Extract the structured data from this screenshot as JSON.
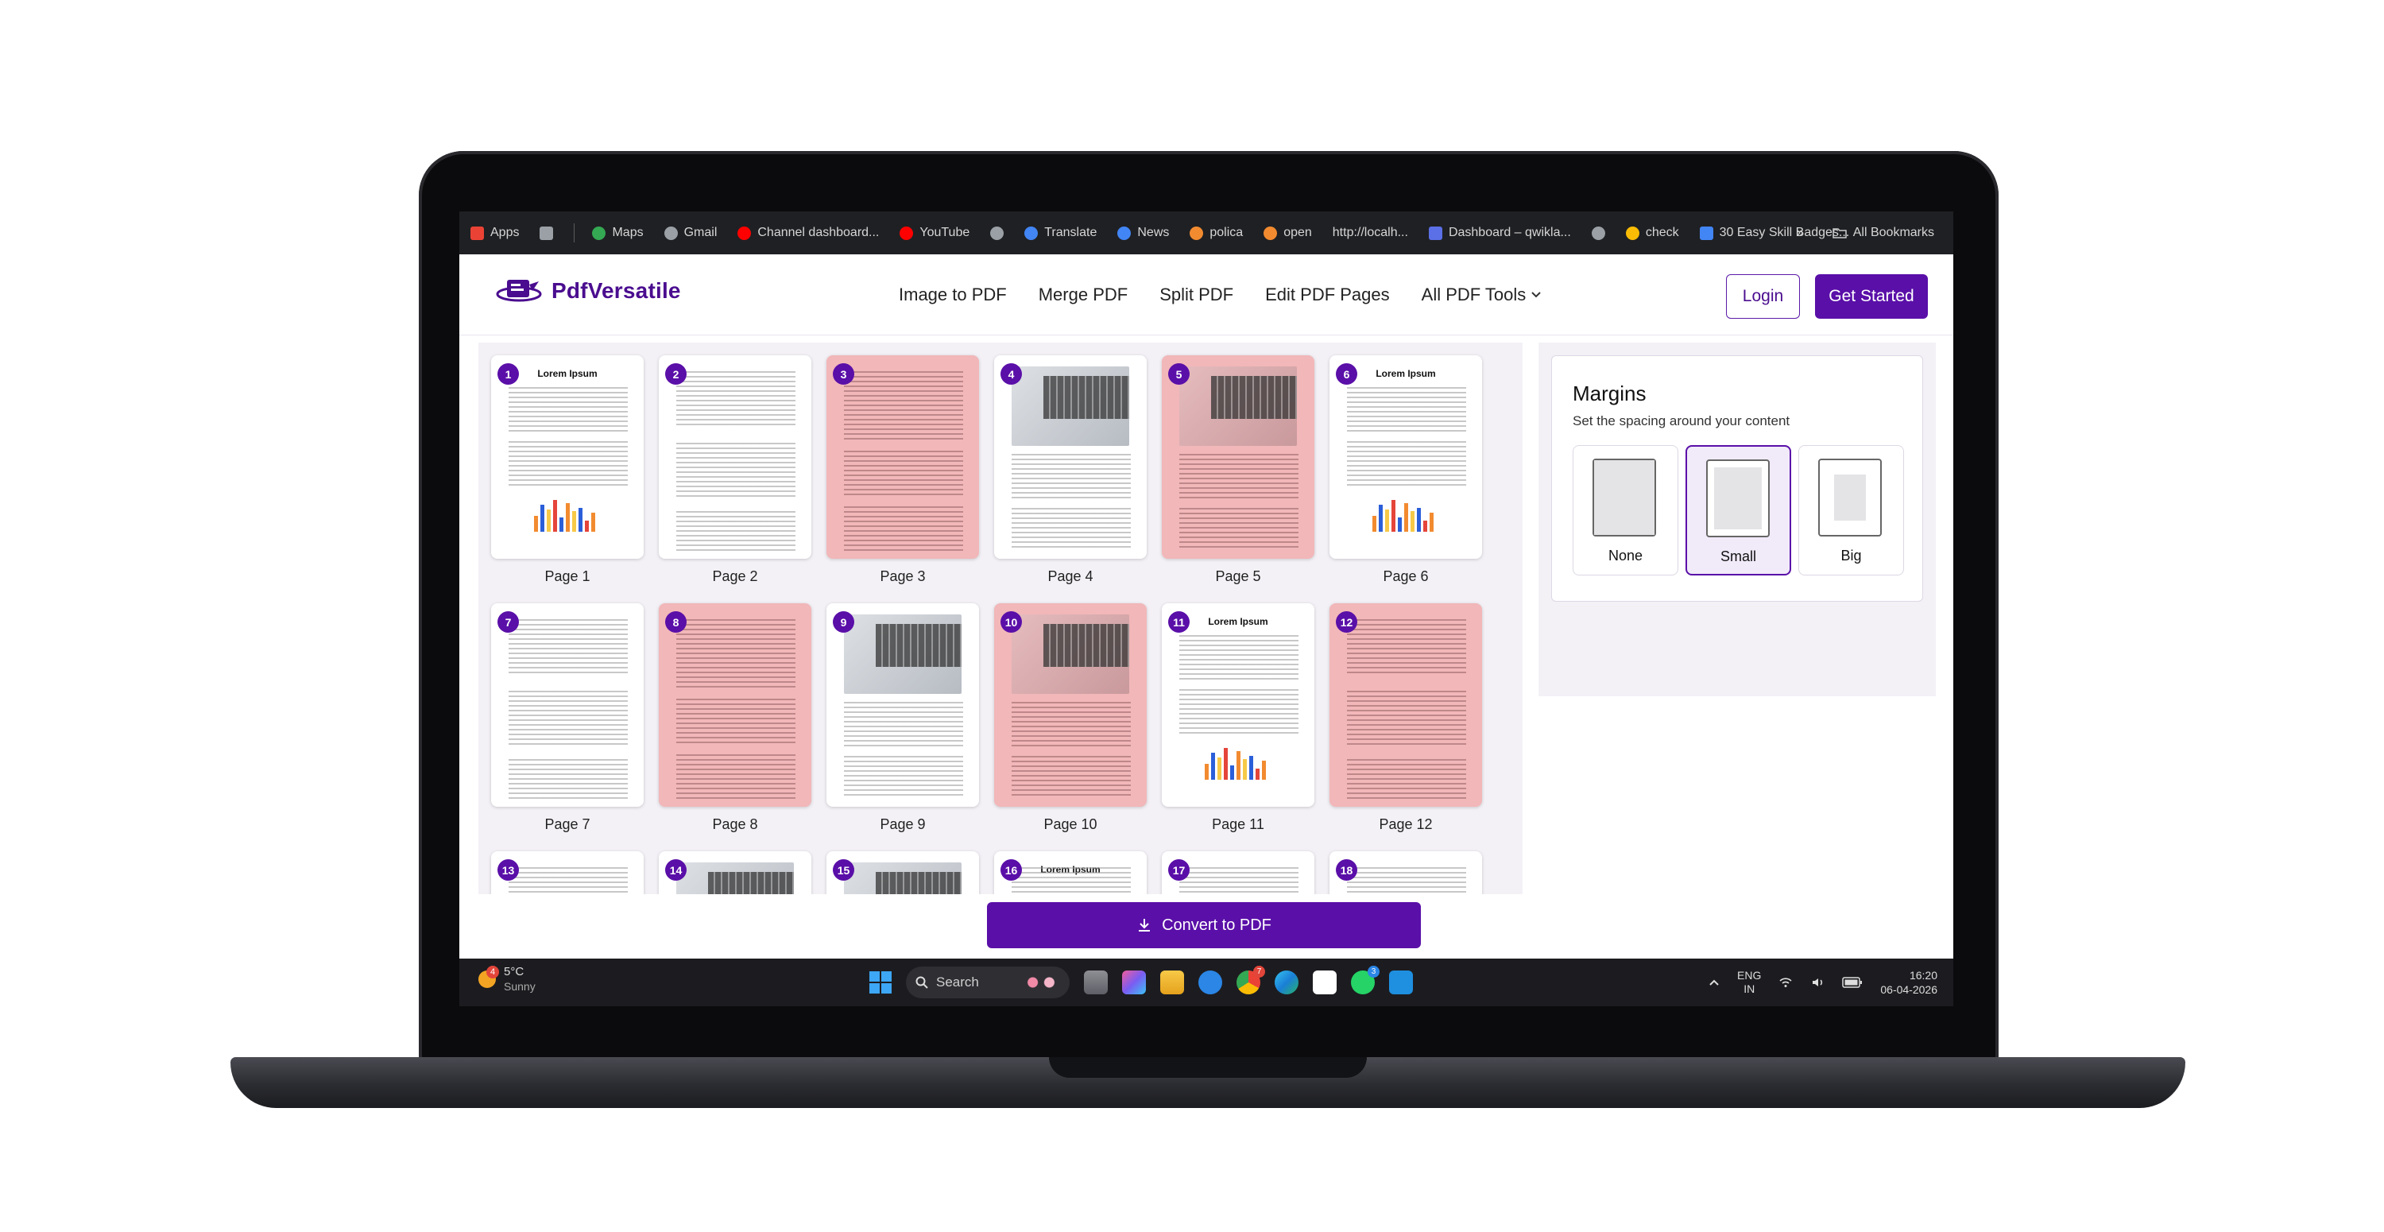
{
  "colors": {
    "brand": "#5a0fa8",
    "page_pink": "#f2b7b9",
    "taskbar": "#1c1c20",
    "bookmarks_bar": "#1f2023"
  },
  "bookmarks": {
    "items": [
      {
        "label": "Apps",
        "icon": "apps-grid-icon"
      },
      {
        "label": "",
        "icon": "tab-groups-icon"
      },
      {
        "label": "Maps",
        "icon": "maps-pin-icon"
      },
      {
        "label": "Gmail",
        "icon": "globe-icon"
      },
      {
        "label": "Channel dashboard...",
        "icon": "youtube-icon"
      },
      {
        "label": "YouTube",
        "icon": "youtube-icon"
      },
      {
        "label": "",
        "icon": "globe-icon"
      },
      {
        "label": "Translate",
        "icon": "translate-icon"
      },
      {
        "label": "News",
        "icon": "news-icon"
      },
      {
        "label": "polica",
        "icon": "orange-app-icon"
      },
      {
        "label": "open",
        "icon": "orange-app-icon"
      },
      {
        "label": "http://localh...",
        "icon": "none"
      },
      {
        "label": "Dashboard – qwikla...",
        "icon": "dashboard-icon"
      },
      {
        "label": "",
        "icon": "globe-icon"
      },
      {
        "label": "check",
        "icon": "drive-icon"
      },
      {
        "label": "30 Easy Skill Badges...",
        "icon": "docs-icon"
      }
    ],
    "overflow": "»",
    "all_bookmarks": "All Bookmarks"
  },
  "header": {
    "brand": "PdfVersatile",
    "nav": [
      "Image to PDF",
      "Merge PDF",
      "Split PDF",
      "Edit PDF Pages",
      "All PDF Tools"
    ],
    "login": "Login",
    "get_started": "Get Started"
  },
  "pages": [
    {
      "num": "1",
      "label": "Page 1",
      "style": "text-chart",
      "pink": false,
      "title": "Lorem Ipsum"
    },
    {
      "num": "2",
      "label": "Page 2",
      "style": "text-table",
      "pink": false
    },
    {
      "num": "3",
      "label": "Page 3",
      "style": "text",
      "pink": true
    },
    {
      "num": "4",
      "label": "Page 4",
      "style": "image",
      "pink": false
    },
    {
      "num": "5",
      "label": "Page 5",
      "style": "image",
      "pink": true
    },
    {
      "num": "6",
      "label": "Page 6",
      "style": "text-chart",
      "pink": false,
      "title": "Lorem Ipsum"
    },
    {
      "num": "7",
      "label": "Page 7",
      "style": "text-table",
      "pink": false
    },
    {
      "num": "8",
      "label": "Page 8",
      "style": "text",
      "pink": true
    },
    {
      "num": "9",
      "label": "Page 9",
      "style": "image",
      "pink": false
    },
    {
      "num": "10",
      "label": "Page 10",
      "style": "image",
      "pink": true
    },
    {
      "num": "11",
      "label": "Page 11",
      "style": "text-chart",
      "pink": false,
      "title": "Lorem Ipsum"
    },
    {
      "num": "12",
      "label": "Page 12",
      "style": "text-table",
      "pink": true
    },
    {
      "num": "13",
      "label": "",
      "style": "text",
      "pink": false
    },
    {
      "num": "14",
      "label": "",
      "style": "image",
      "pink": false
    },
    {
      "num": "15",
      "label": "",
      "style": "image",
      "pink": false
    },
    {
      "num": "16",
      "label": "",
      "style": "text",
      "pink": false,
      "title": "Lorem Ipsum"
    },
    {
      "num": "17",
      "label": "",
      "style": "text",
      "pink": false
    },
    {
      "num": "18",
      "label": "",
      "style": "text",
      "pink": false
    }
  ],
  "margins": {
    "title": "Margins",
    "subtitle": "Set the spacing around your content",
    "options": [
      {
        "label": "None",
        "selected": false
      },
      {
        "label": "Small",
        "selected": true
      },
      {
        "label": "Big",
        "selected": false
      }
    ]
  },
  "convert_button": "Convert to PDF",
  "taskbar": {
    "weather_temp": "5°C",
    "weather_cond": "Sunny",
    "weather_badge": "4",
    "search_placeholder": "Search",
    "chrome_badge": "7",
    "whatsapp_badge": "3",
    "lang_top": "ENG",
    "lang_bottom": "IN",
    "time": "16:20",
    "date": "06-04-2026"
  }
}
